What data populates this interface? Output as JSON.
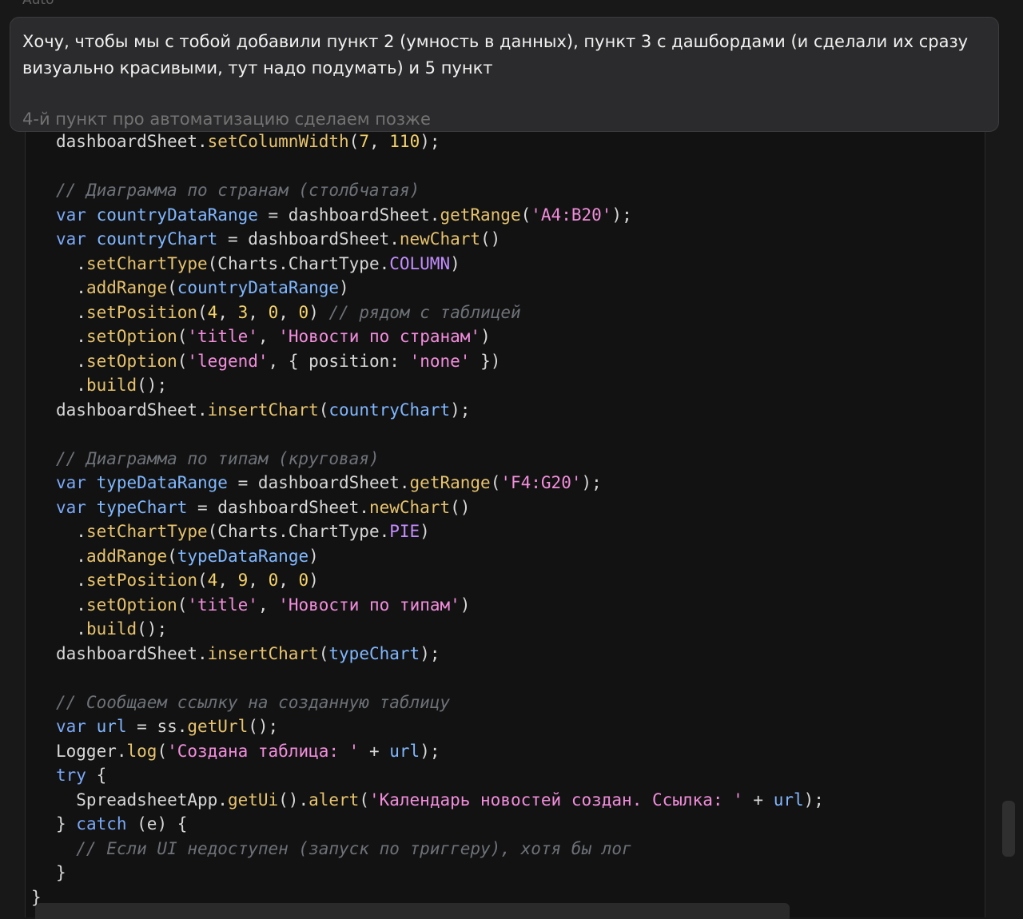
{
  "header_hint": "Auto",
  "prompt": {
    "line1": "Хочу, чтобы мы с тобой добавили пункт 2 (умность в данных), пункт 3 с дашбордами (и сделали их сразу",
    "line2": "визуально красивыми, тут надо подумать) и 5 пункт",
    "line3": "4-й пункт про автоматизацию сделаем позже"
  },
  "code_lines": [
    [
      {
        "text": "dashboardSheet.",
        "type": "punct"
      },
      {
        "text": "setColumnWidth",
        "type": "fn"
      },
      {
        "text": "(",
        "type": "punct"
      },
      {
        "text": "7",
        "type": "num"
      },
      {
        "text": ", ",
        "type": "punct"
      },
      {
        "text": "110",
        "type": "num"
      },
      {
        "text": ");",
        "type": "punct"
      }
    ],
    [],
    [
      {
        "text": "// Диаграмма по странам (столбчатая)",
        "type": "comment"
      }
    ],
    [
      {
        "text": "var ",
        "type": "kw"
      },
      {
        "text": "countryDataRange",
        "type": "var"
      },
      {
        "text": " = dashboardSheet.",
        "type": "punct"
      },
      {
        "text": "getRange",
        "type": "fn"
      },
      {
        "text": "(",
        "type": "punct"
      },
      {
        "text": "'A4:B20'",
        "type": "str"
      },
      {
        "text": ");",
        "type": "punct"
      }
    ],
    [
      {
        "text": "var ",
        "type": "kw"
      },
      {
        "text": "countryChart",
        "type": "var"
      },
      {
        "text": " = dashboardSheet.",
        "type": "punct"
      },
      {
        "text": "newChart",
        "type": "fn"
      },
      {
        "text": "()",
        "type": "punct"
      }
    ],
    [
      {
        "text": "  .",
        "type": "punct"
      },
      {
        "text": "setChartType",
        "type": "fn"
      },
      {
        "text": "(Charts.ChartType.",
        "type": "punct"
      },
      {
        "text": "COLUMN",
        "type": "const"
      },
      {
        "text": ")",
        "type": "punct"
      }
    ],
    [
      {
        "text": "  .",
        "type": "punct"
      },
      {
        "text": "addRange",
        "type": "fn"
      },
      {
        "text": "(",
        "type": "punct"
      },
      {
        "text": "countryDataRange",
        "type": "var"
      },
      {
        "text": ")",
        "type": "punct"
      }
    ],
    [
      {
        "text": "  .",
        "type": "punct"
      },
      {
        "text": "setPosition",
        "type": "fn"
      },
      {
        "text": "(",
        "type": "punct"
      },
      {
        "text": "4",
        "type": "num"
      },
      {
        "text": ", ",
        "type": "punct"
      },
      {
        "text": "3",
        "type": "num"
      },
      {
        "text": ", ",
        "type": "punct"
      },
      {
        "text": "0",
        "type": "num"
      },
      {
        "text": ", ",
        "type": "punct"
      },
      {
        "text": "0",
        "type": "num"
      },
      {
        "text": ") ",
        "type": "punct"
      },
      {
        "text": "// рядом с таблицей",
        "type": "comment"
      }
    ],
    [
      {
        "text": "  .",
        "type": "punct"
      },
      {
        "text": "setOption",
        "type": "fn"
      },
      {
        "text": "(",
        "type": "punct"
      },
      {
        "text": "'title'",
        "type": "str"
      },
      {
        "text": ", ",
        "type": "punct"
      },
      {
        "text": "'Новости по странам'",
        "type": "str"
      },
      {
        "text": ")",
        "type": "punct"
      }
    ],
    [
      {
        "text": "  .",
        "type": "punct"
      },
      {
        "text": "setOption",
        "type": "fn"
      },
      {
        "text": "(",
        "type": "punct"
      },
      {
        "text": "'legend'",
        "type": "str"
      },
      {
        "text": ", { position: ",
        "type": "punct"
      },
      {
        "text": "'none'",
        "type": "str"
      },
      {
        "text": " })",
        "type": "punct"
      }
    ],
    [
      {
        "text": "  .",
        "type": "punct"
      },
      {
        "text": "build",
        "type": "fn"
      },
      {
        "text": "();",
        "type": "punct"
      }
    ],
    [
      {
        "text": "dashboardSheet.",
        "type": "punct"
      },
      {
        "text": "insertChart",
        "type": "fn"
      },
      {
        "text": "(",
        "type": "punct"
      },
      {
        "text": "countryChart",
        "type": "var"
      },
      {
        "text": ");",
        "type": "punct"
      }
    ],
    [],
    [
      {
        "text": "// Диаграмма по типам (круговая)",
        "type": "comment"
      }
    ],
    [
      {
        "text": "var ",
        "type": "kw"
      },
      {
        "text": "typeDataRange",
        "type": "var"
      },
      {
        "text": " = dashboardSheet.",
        "type": "punct"
      },
      {
        "text": "getRange",
        "type": "fn"
      },
      {
        "text": "(",
        "type": "punct"
      },
      {
        "text": "'F4:G20'",
        "type": "str"
      },
      {
        "text": ");",
        "type": "punct"
      }
    ],
    [
      {
        "text": "var ",
        "type": "kw"
      },
      {
        "text": "typeChart",
        "type": "var"
      },
      {
        "text": " = dashboardSheet.",
        "type": "punct"
      },
      {
        "text": "newChart",
        "type": "fn"
      },
      {
        "text": "()",
        "type": "punct"
      }
    ],
    [
      {
        "text": "  .",
        "type": "punct"
      },
      {
        "text": "setChartType",
        "type": "fn"
      },
      {
        "text": "(Charts.ChartType.",
        "type": "punct"
      },
      {
        "text": "PIE",
        "type": "const"
      },
      {
        "text": ")",
        "type": "punct"
      }
    ],
    [
      {
        "text": "  .",
        "type": "punct"
      },
      {
        "text": "addRange",
        "type": "fn"
      },
      {
        "text": "(",
        "type": "punct"
      },
      {
        "text": "typeDataRange",
        "type": "var"
      },
      {
        "text": ")",
        "type": "punct"
      }
    ],
    [
      {
        "text": "  .",
        "type": "punct"
      },
      {
        "text": "setPosition",
        "type": "fn"
      },
      {
        "text": "(",
        "type": "punct"
      },
      {
        "text": "4",
        "type": "num"
      },
      {
        "text": ", ",
        "type": "punct"
      },
      {
        "text": "9",
        "type": "num"
      },
      {
        "text": ", ",
        "type": "punct"
      },
      {
        "text": "0",
        "type": "num"
      },
      {
        "text": ", ",
        "type": "punct"
      },
      {
        "text": "0",
        "type": "num"
      },
      {
        "text": ")",
        "type": "punct"
      }
    ],
    [
      {
        "text": "  .",
        "type": "punct"
      },
      {
        "text": "setOption",
        "type": "fn"
      },
      {
        "text": "(",
        "type": "punct"
      },
      {
        "text": "'title'",
        "type": "str"
      },
      {
        "text": ", ",
        "type": "punct"
      },
      {
        "text": "'Новости по типам'",
        "type": "str"
      },
      {
        "text": ")",
        "type": "punct"
      }
    ],
    [
      {
        "text": "  .",
        "type": "punct"
      },
      {
        "text": "build",
        "type": "fn"
      },
      {
        "text": "();",
        "type": "punct"
      }
    ],
    [
      {
        "text": "dashboardSheet.",
        "type": "punct"
      },
      {
        "text": "insertChart",
        "type": "fn"
      },
      {
        "text": "(",
        "type": "punct"
      },
      {
        "text": "typeChart",
        "type": "var"
      },
      {
        "text": ");",
        "type": "punct"
      }
    ],
    [],
    [
      {
        "text": "// Сообщаем ссылку на созданную таблицу",
        "type": "comment"
      }
    ],
    [
      {
        "text": "var ",
        "type": "kw"
      },
      {
        "text": "url",
        "type": "var"
      },
      {
        "text": " = ss.",
        "type": "punct"
      },
      {
        "text": "getUrl",
        "type": "fn"
      },
      {
        "text": "();",
        "type": "punct"
      }
    ],
    [
      {
        "text": "Logger.",
        "type": "punct"
      },
      {
        "text": "log",
        "type": "fn"
      },
      {
        "text": "(",
        "type": "punct"
      },
      {
        "text": "'Создана таблица: '",
        "type": "str"
      },
      {
        "text": " + ",
        "type": "punct"
      },
      {
        "text": "url",
        "type": "var"
      },
      {
        "text": ");",
        "type": "punct"
      }
    ],
    [
      {
        "text": "try",
        "type": "kw"
      },
      {
        "text": " {",
        "type": "punct"
      }
    ],
    [
      {
        "text": "  SpreadsheetApp.",
        "type": "punct"
      },
      {
        "text": "getUi",
        "type": "fn"
      },
      {
        "text": "().",
        "type": "punct"
      },
      {
        "text": "alert",
        "type": "fn"
      },
      {
        "text": "(",
        "type": "punct"
      },
      {
        "text": "'Календарь новостей создан. Ссылка: '",
        "type": "str"
      },
      {
        "text": " + ",
        "type": "punct"
      },
      {
        "text": "url",
        "type": "var"
      },
      {
        "text": ");",
        "type": "punct"
      }
    ],
    [
      {
        "text": "} ",
        "type": "punct"
      },
      {
        "text": "catch",
        "type": "kw"
      },
      {
        "text": " (e) {",
        "type": "punct"
      }
    ],
    [
      {
        "text": "  // Если UI недоступен (запуск по триггеру), хотя бы лог",
        "type": "comment"
      }
    ],
    [
      {
        "text": "}",
        "type": "punct"
      }
    ],
    [
      {
        "text": "}",
        "type": "punct"
      }
    ]
  ]
}
